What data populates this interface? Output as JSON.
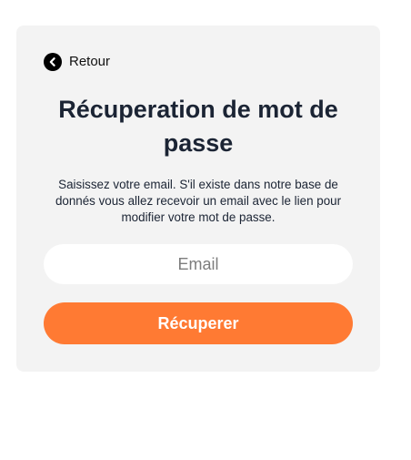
{
  "back": {
    "icon": "chevron-left-circle-icon",
    "label": "Retour"
  },
  "title": "Récuperation de mot de passe",
  "description": "Saisissez votre email. S'il existe dans notre base de donnés vous allez recevoir un email avec le lien pour modifier votre mot de passe.",
  "email": {
    "placeholder": "Email",
    "value": ""
  },
  "submit": {
    "label": "Récuperer"
  },
  "colors": {
    "card_background": "#f3f3f3",
    "title_text": "#1b2434",
    "button_background": "#ff7a33",
    "button_text": "#ffffff",
    "input_background": "#ffffff"
  }
}
